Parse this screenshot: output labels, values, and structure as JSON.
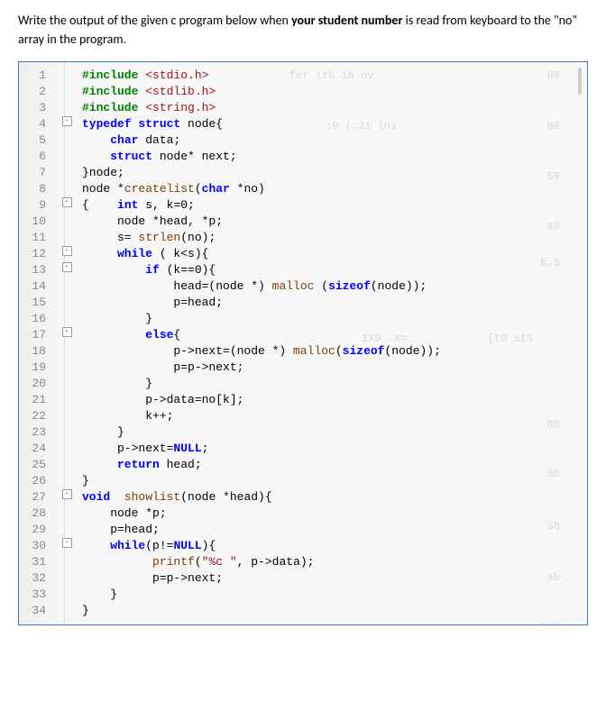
{
  "instruction_before": "Write the output of the given c program below when ",
  "instruction_bold": "your student number",
  "instruction_after": " is read from keyboard to the \"no\" array in the program.",
  "lines": [
    {
      "ln": "1",
      "fold": "",
      "segs": [
        {
          "t": "#include ",
          "c": "pp"
        },
        {
          "t": "<stdio.h>",
          "c": "str"
        }
      ]
    },
    {
      "ln": "2",
      "fold": "",
      "segs": [
        {
          "t": "#include ",
          "c": "pp"
        },
        {
          "t": "<stdlib.h>",
          "c": "str"
        }
      ]
    },
    {
      "ln": "3",
      "fold": "",
      "segs": [
        {
          "t": "#include ",
          "c": "pp"
        },
        {
          "t": "<string.h>",
          "c": "str"
        }
      ]
    },
    {
      "ln": "4",
      "fold": "-",
      "segs": [
        {
          "t": "typedef struct ",
          "c": "kw"
        },
        {
          "t": "node{",
          "c": "plain"
        }
      ]
    },
    {
      "ln": "5",
      "fold": "",
      "segs": [
        {
          "t": "    ",
          "c": "plain"
        },
        {
          "t": "char ",
          "c": "kw"
        },
        {
          "t": "data;",
          "c": "plain"
        }
      ]
    },
    {
      "ln": "6",
      "fold": "",
      "segs": [
        {
          "t": "    ",
          "c": "plain"
        },
        {
          "t": "struct ",
          "c": "kw"
        },
        {
          "t": "node* next;",
          "c": "plain"
        }
      ]
    },
    {
      "ln": "7",
      "fold": "",
      "segs": [
        {
          "t": "}node;",
          "c": "plain"
        }
      ]
    },
    {
      "ln": "8",
      "fold": "",
      "segs": [
        {
          "t": "node *",
          "c": "plain"
        },
        {
          "t": "createlist",
          "c": "fn"
        },
        {
          "t": "(",
          "c": "plain"
        },
        {
          "t": "char ",
          "c": "kw"
        },
        {
          "t": "*no)",
          "c": "plain"
        }
      ]
    },
    {
      "ln": "9",
      "fold": "-",
      "segs": [
        {
          "t": "{",
          "c": "plain"
        },
        {
          "t": "    int ",
          "c": "kw"
        },
        {
          "t": "s, k=0;",
          "c": "plain"
        }
      ]
    },
    {
      "ln": "10",
      "fold": "",
      "segs": [
        {
          "t": "     node *head, *p;",
          "c": "plain"
        }
      ]
    },
    {
      "ln": "11",
      "fold": "",
      "segs": [
        {
          "t": "     s= ",
          "c": "plain"
        },
        {
          "t": "strlen",
          "c": "fn"
        },
        {
          "t": "(no);",
          "c": "plain"
        }
      ]
    },
    {
      "ln": "12",
      "fold": "-",
      "segs": [
        {
          "t": "     while ",
          "c": "kw"
        },
        {
          "t": "( k<s){",
          "c": "plain"
        }
      ]
    },
    {
      "ln": "13",
      "fold": "-",
      "segs": [
        {
          "t": "         if ",
          "c": "kw"
        },
        {
          "t": "(k==0){",
          "c": "plain"
        }
      ]
    },
    {
      "ln": "14",
      "fold": "",
      "segs": [
        {
          "t": "             head=(node *) ",
          "c": "plain"
        },
        {
          "t": "malloc",
          "c": "fn"
        },
        {
          "t": " (",
          "c": "plain"
        },
        {
          "t": "sizeof",
          "c": "kw"
        },
        {
          "t": "(node));",
          "c": "plain"
        }
      ]
    },
    {
      "ln": "15",
      "fold": "",
      "segs": [
        {
          "t": "             p=head;",
          "c": "plain"
        }
      ]
    },
    {
      "ln": "16",
      "fold": "",
      "segs": [
        {
          "t": "         }",
          "c": "plain"
        }
      ]
    },
    {
      "ln": "17",
      "fold": "-",
      "segs": [
        {
          "t": "         else",
          "c": "kw"
        },
        {
          "t": "{",
          "c": "plain"
        }
      ]
    },
    {
      "ln": "18",
      "fold": "",
      "segs": [
        {
          "t": "             p->next=(node *) ",
          "c": "plain"
        },
        {
          "t": "malloc",
          "c": "fn"
        },
        {
          "t": "(",
          "c": "plain"
        },
        {
          "t": "sizeof",
          "c": "kw"
        },
        {
          "t": "(node));",
          "c": "plain"
        }
      ]
    },
    {
      "ln": "19",
      "fold": "",
      "segs": [
        {
          "t": "             p=p->next;",
          "c": "plain"
        }
      ]
    },
    {
      "ln": "20",
      "fold": "",
      "segs": [
        {
          "t": "         }",
          "c": "plain"
        }
      ]
    },
    {
      "ln": "21",
      "fold": "",
      "segs": [
        {
          "t": "         p->data=no[k];",
          "c": "plain"
        }
      ]
    },
    {
      "ln": "22",
      "fold": "",
      "segs": [
        {
          "t": "         k++;",
          "c": "plain"
        }
      ]
    },
    {
      "ln": "23",
      "fold": "",
      "segs": [
        {
          "t": "     }",
          "c": "plain"
        }
      ]
    },
    {
      "ln": "24",
      "fold": "",
      "segs": [
        {
          "t": "     p->next=",
          "c": "plain"
        },
        {
          "t": "NULL",
          "c": "kw"
        },
        {
          "t": ";",
          "c": "plain"
        }
      ]
    },
    {
      "ln": "25",
      "fold": "",
      "segs": [
        {
          "t": "     return ",
          "c": "kw"
        },
        {
          "t": "head;",
          "c": "plain"
        }
      ]
    },
    {
      "ln": "26",
      "fold": "",
      "segs": [
        {
          "t": "}",
          "c": "plain"
        }
      ]
    },
    {
      "ln": "27",
      "fold": "-",
      "segs": [
        {
          "t": "void ",
          "c": "kw"
        },
        {
          "t": " showlist",
          "c": "fn"
        },
        {
          "t": "(node *head){",
          "c": "plain"
        }
      ]
    },
    {
      "ln": "28",
      "fold": "",
      "segs": [
        {
          "t": "    node *p;",
          "c": "plain"
        }
      ]
    },
    {
      "ln": "29",
      "fold": "",
      "segs": [
        {
          "t": "    p=head;",
          "c": "plain"
        }
      ]
    },
    {
      "ln": "30",
      "fold": "-",
      "segs": [
        {
          "t": "    while",
          "c": "kw"
        },
        {
          "t": "(p!=",
          "c": "plain"
        },
        {
          "t": "NULL",
          "c": "kw"
        },
        {
          "t": "){",
          "c": "plain"
        }
      ]
    },
    {
      "ln": "31",
      "fold": "",
      "segs": [
        {
          "t": "          printf",
          "c": "fn"
        },
        {
          "t": "(",
          "c": "plain"
        },
        {
          "t": "\"%c \"",
          "c": "str"
        },
        {
          "t": ", p->data);",
          "c": "plain"
        }
      ]
    },
    {
      "ln": "32",
      "fold": "",
      "segs": [
        {
          "t": "          p=p->next;",
          "c": "plain"
        }
      ]
    },
    {
      "ln": "33",
      "fold": "",
      "segs": [
        {
          "t": "    }",
          "c": "plain"
        }
      ]
    },
    {
      "ln": "34",
      "fold": "",
      "segs": [
        {
          "t": "}",
          "c": "plain"
        }
      ]
    }
  ]
}
